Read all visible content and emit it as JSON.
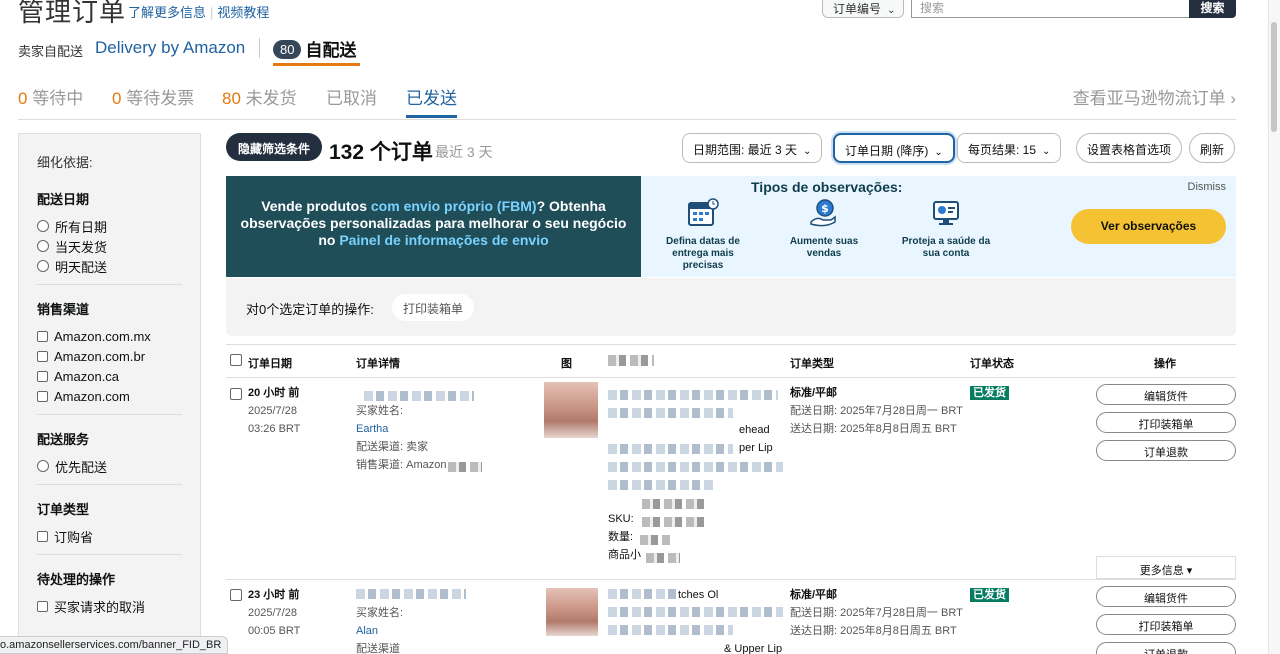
{
  "header": {
    "title": "管理订单",
    "help_link": "了解更多信息",
    "video_link": "视频教程",
    "search_select": "订单编号",
    "search_placeholder": "搜索",
    "search_button": "搜索"
  },
  "fulfillment": {
    "label": "卖家自配送",
    "amazon": "Delivery by Amazon",
    "self_count": "80",
    "self_label": "自配送"
  },
  "tabs": [
    {
      "count": "0",
      "label": " 等待中"
    },
    {
      "count": "0",
      "label": " 等待发票"
    },
    {
      "count": "80",
      "label": " 未发货"
    },
    {
      "count": "",
      "label": "已取消"
    },
    {
      "count": "",
      "label": "已发送"
    }
  ],
  "tabs_right": "查看亚马逊物流订单 ›",
  "sidebar": {
    "title": "细化依据:",
    "groups": [
      {
        "title": "配送日期",
        "type": "radio",
        "options": [
          "所有日期",
          "当天发货",
          "明天配送"
        ]
      },
      {
        "title": "销售渠道",
        "type": "checkbox",
        "options": [
          "Amazon.com.mx",
          "Amazon.com.br",
          "Amazon.ca",
          "Amazon.com"
        ]
      },
      {
        "title": "配送服务",
        "type": "radio",
        "options": [
          "优先配送"
        ]
      },
      {
        "title": "订单类型",
        "type": "checkbox",
        "options": [
          "订购省"
        ]
      },
      {
        "title": "待处理的操作",
        "type": "checkbox",
        "options": [
          "买家请求的取消"
        ]
      }
    ]
  },
  "toolbar": {
    "hide_filters": "隐藏筛选条件",
    "order_count": "132 个订单",
    "recent": "最近 3 天",
    "date_range": "日期范围:   最近 3 天",
    "sort": "订单日期 (降序)",
    "per_page": "每页结果:   15",
    "table_prefs": "设置表格首选项",
    "refresh": "刷新"
  },
  "banner": {
    "text_1": "Vende produtos ",
    "text_hl_1": "com envio próprio (FBM)",
    "text_2": "? Obtenha observações personalizadas para melhorar o seu negócio no ",
    "text_hl_2": "Painel de informações de envio",
    "tipos": "Tipos de observações:",
    "dismiss": "Dismiss",
    "features": [
      {
        "icon": "calendar-icon",
        "label": "Defina datas de entrega mais precisas"
      },
      {
        "icon": "money-hand-icon",
        "label": "Aumente suas vendas"
      },
      {
        "icon": "monitor-chart-icon",
        "label": "Proteja a saúde da sua conta"
      }
    ],
    "cta": "Ver observações"
  },
  "bulk": {
    "label": "对0个选定订单的操作:",
    "print_button": "打印装箱单"
  },
  "table": {
    "headers": {
      "date": "订单日期",
      "details": "订单详情",
      "image": "图",
      "product": "",
      "type": "订单类型",
      "status": "订单状态",
      "actions": "操作"
    },
    "rows": [
      {
        "age": "20 小时 前",
        "date": "2025/7/28",
        "time": "03:26 BRT",
        "buyer_label": "买家姓名:",
        "buyer": "Eartha",
        "channel": "配送渠道: 卖家",
        "sales_channel": "销售渠道: Amazon",
        "product_frag_1": "ehead",
        "product_frag_2": "per Lip",
        "asin": "",
        "sku_label": "SKU: ",
        "qty_label": "数量: ",
        "subtotal_label": "商品小",
        "type": "标准/平邮",
        "ship_date": "配送日期: 2025年7月28日周一 BRT",
        "deliver_date": "送达日期: 2025年8月8日周五 BRT",
        "status": "已发货",
        "actions": [
          "编辑货件",
          "打印装箱单",
          "订单退款"
        ],
        "more": "更多信息 ▾"
      },
      {
        "age": "23 小时 前",
        "date": "2025/7/28",
        "time": "00:05 BRT",
        "buyer_label": "买家姓名:",
        "buyer": "Alan",
        "channel": "配送渠道",
        "product_frag_1": "tches Ol",
        "product_frag_2": "& Upper Lip",
        "type": "标准/平邮",
        "ship_date": "配送日期: 2025年7月28日周一 BRT",
        "deliver_date": "送达日期: 2025年8月8日周五 BRT",
        "status": "已发货",
        "actions": [
          "编辑货件",
          "打印装箱单",
          "订单退款"
        ]
      }
    ]
  },
  "statusbar_url": "o.amazonsellerservices.com/banner_FID_BR"
}
